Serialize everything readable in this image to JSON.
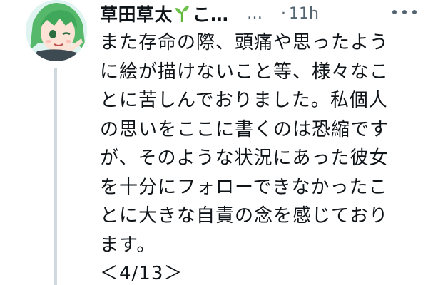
{
  "tweet": {
    "display_name": "草田草太",
    "name_truncation": "こ…",
    "handle": "…",
    "separator": "·",
    "time": "11h",
    "icons": {
      "avatar": "avatar-anime-girl",
      "badge": "sprout-icon",
      "more": "more-icon"
    },
    "body_lines": [
      "また存命の際、頭痛や思ったよう",
      "に絵が描けないこと等、様々なこ",
      "とに苦しんでおりました。私個人",
      "の思いをここに書くのは恐縮です",
      "が、そのような状況にあった彼女",
      "を十分にフォローできなかったこ",
      "とに大きな自責の念を感じており",
      "ます。",
      "＜4/13＞"
    ]
  },
  "colors": {
    "text": "#0f1419",
    "secondary": "#536471",
    "thread_line": "#cfd9de",
    "accent_green": "#5fb83a"
  }
}
